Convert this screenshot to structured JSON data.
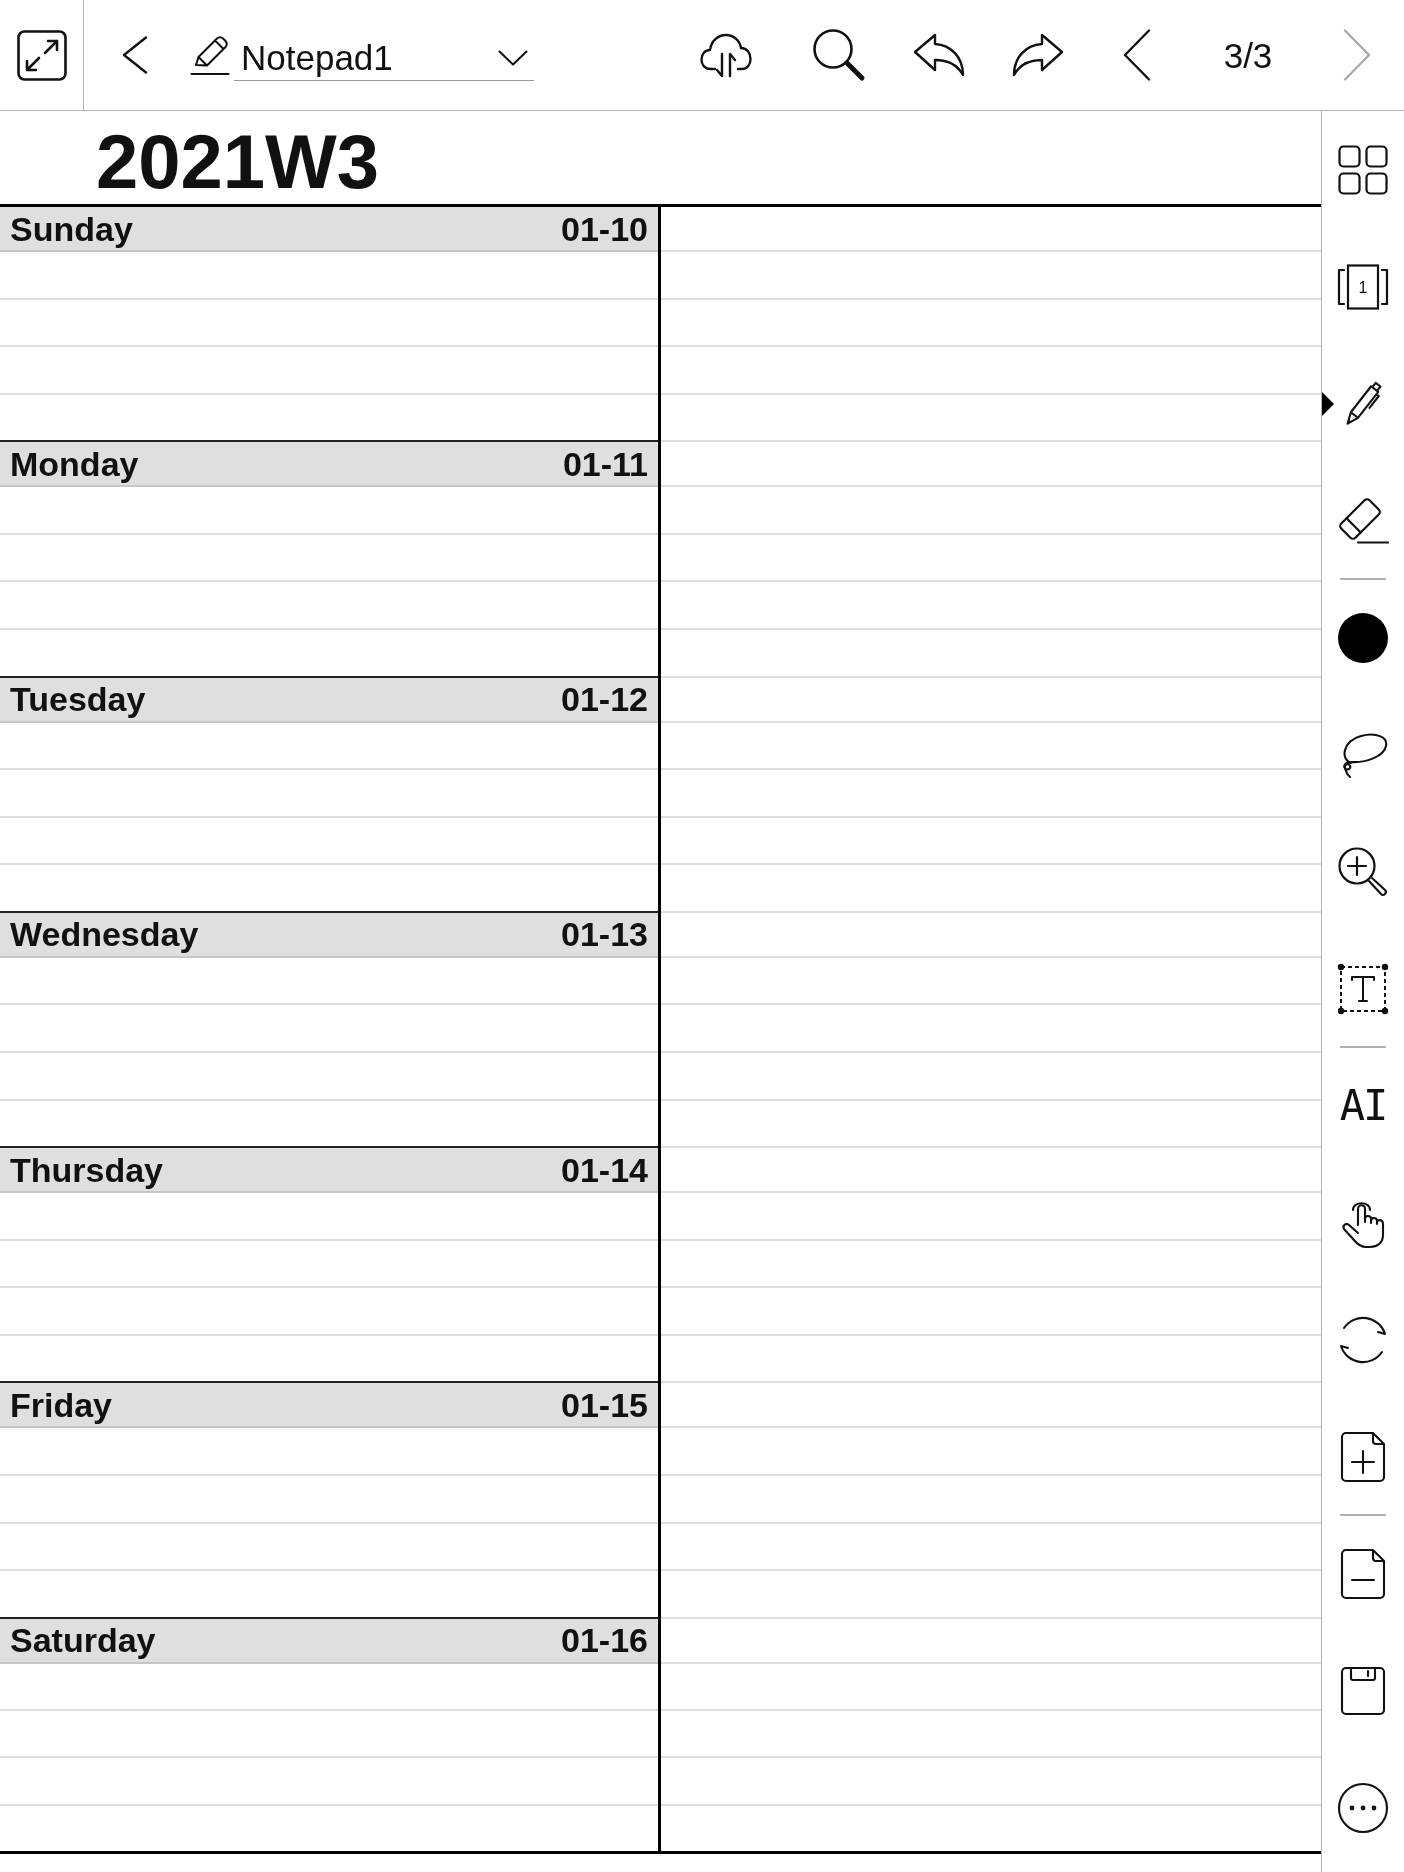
{
  "toolbar": {
    "left_buttons": [
      {
        "kind": "expand"
      },
      {
        "kind": "back"
      }
    ],
    "title": {
      "value": "Notepad1"
    },
    "actions": [
      {
        "kind": "cloud_sync"
      },
      {
        "kind": "search"
      },
      {
        "kind": "undo"
      },
      {
        "kind": "redo"
      }
    ],
    "pager": {
      "previous": {
        "disabled": false
      },
      "page": "3/3",
      "next": {
        "disabled": true
      }
    }
  },
  "planner": {
    "title": "2021W3",
    "days": [
      {
        "name": "Sunday",
        "date": "01-10"
      },
      {
        "name": "Monday",
        "date": "01-11"
      },
      {
        "name": "Tuesday",
        "date": "01-12"
      },
      {
        "name": "Wednesday",
        "date": "01-13"
      },
      {
        "name": "Thursday",
        "date": "01-14"
      },
      {
        "name": "Friday",
        "date": "01-15"
      },
      {
        "name": "Saturday",
        "date": "01-16"
      }
    ]
  },
  "sidebar": {
    "groups": [
      [
        {
          "kind": "grid",
          "selected": false
        },
        {
          "kind": "page_view",
          "label": "1",
          "selected": false
        },
        {
          "kind": "pen",
          "selected": true
        },
        {
          "kind": "eraser",
          "selected": false
        }
      ],
      [
        {
          "kind": "color",
          "color": "#000000",
          "selected": false
        },
        {
          "kind": "lasso",
          "selected": false
        },
        {
          "kind": "zoom",
          "selected": false
        },
        {
          "kind": "text_box",
          "selected": false
        }
      ],
      [
        {
          "kind": "ai_text",
          "label": "AI",
          "selected": false
        },
        {
          "kind": "touch",
          "selected": false
        },
        {
          "kind": "sync",
          "selected": false
        },
        {
          "kind": "add_page",
          "selected": false
        }
      ],
      [
        {
          "kind": "delete_page",
          "selected": false
        },
        {
          "kind": "save",
          "selected": false
        },
        {
          "kind": "more",
          "selected": false
        }
      ]
    ]
  }
}
